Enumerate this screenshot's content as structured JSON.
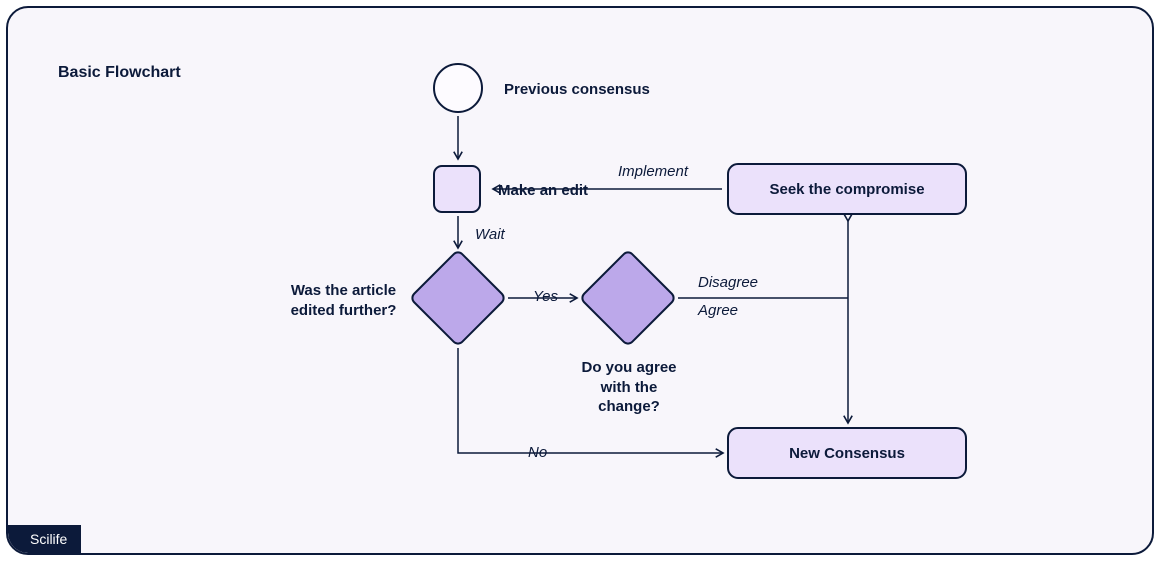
{
  "header": {
    "title": "Basic Flowchart"
  },
  "brand": "Scilife",
  "nodes": {
    "start": {
      "label": "Previous consensus"
    },
    "edit": {
      "label": "Make an edit"
    },
    "decision_edited": {
      "label": "Was the article edited further?"
    },
    "decision_agree": {
      "label": "Do you agree with the change?"
    },
    "compromise": {
      "label": "Seek the compromise"
    },
    "consensus": {
      "label": "New Consensus"
    }
  },
  "edges": {
    "wait": "Wait",
    "yes": "Yes",
    "no": "No",
    "disagree": "Disagree",
    "agree": "Agree",
    "implement": "Implement"
  },
  "chart_data": {
    "type": "flowchart",
    "title": "Basic Flowchart",
    "nodes": [
      {
        "id": "prev_consensus",
        "shape": "circle",
        "label": "Previous consensus"
      },
      {
        "id": "make_edit",
        "shape": "process",
        "label": "Make an edit"
      },
      {
        "id": "edited_further",
        "shape": "decision",
        "label": "Was the article edited further?"
      },
      {
        "id": "agree_change",
        "shape": "decision",
        "label": "Do you agree with the change?"
      },
      {
        "id": "seek_compromise",
        "shape": "process",
        "label": "Seek the compromise"
      },
      {
        "id": "new_consensus",
        "shape": "process",
        "label": "New Consensus"
      }
    ],
    "edges": [
      {
        "from": "prev_consensus",
        "to": "make_edit",
        "label": ""
      },
      {
        "from": "make_edit",
        "to": "edited_further",
        "label": "Wait"
      },
      {
        "from": "edited_further",
        "to": "agree_change",
        "label": "Yes"
      },
      {
        "from": "edited_further",
        "to": "new_consensus",
        "label": "No"
      },
      {
        "from": "agree_change",
        "to": "seek_compromise",
        "label": "Disagree"
      },
      {
        "from": "agree_change",
        "to": "new_consensus",
        "label": "Agree"
      },
      {
        "from": "seek_compromise",
        "to": "make_edit",
        "label": "Implement"
      },
      {
        "from": "seek_compromise",
        "to": "new_consensus",
        "label": ""
      },
      {
        "from": "new_consensus",
        "to": "seek_compromise",
        "label": ""
      }
    ]
  }
}
